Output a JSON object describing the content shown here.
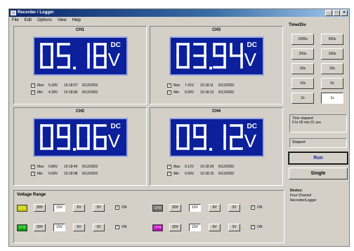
{
  "window": {
    "title": "Recorder / Logger"
  },
  "menu": [
    "File",
    "Edit",
    "Options",
    "View",
    "Help"
  ],
  "channels": [
    {
      "name": "CH1",
      "display": "05.18",
      "dc": "DC",
      "unit": "V",
      "max": {
        "label": "Max",
        "value": "5.18V",
        "time": "10:18:07",
        "date": "6/12/2002"
      },
      "min": {
        "label": "Min",
        "value": "4.28V",
        "time": "10:18:06",
        "date": "6/12/2002"
      }
    },
    {
      "name": "CH3",
      "display": "03.94",
      "dc": "DC",
      "unit": "V",
      "max": {
        "label": "Max",
        "value": "7.41V",
        "time": "10:18:11",
        "date": "6/12/2002"
      },
      "min": {
        "label": "Min",
        "value": "0.00V",
        "time": "10:18:12",
        "date": "6/12/2002"
      }
    },
    {
      "name": "CH2",
      "display": "09.06",
      "dc": "DC",
      "unit": "V",
      "max": {
        "label": "Max",
        "value": "9.86V",
        "time": "10:18:40",
        "date": "6/12/2002"
      },
      "min": {
        "label": "Min",
        "value": "0.00V",
        "time": "10:18:08",
        "date": "6/12/2002"
      }
    },
    {
      "name": "CH4",
      "display": "09.12",
      "dc": "DC",
      "unit": "V",
      "max": {
        "label": "Max",
        "value": "9.12V",
        "time": "10:18:26",
        "date": "6/12/2002"
      },
      "min": {
        "label": "Min",
        "value": "0.00V",
        "time": "10:18:15",
        "date": "6/12/2002"
      }
    }
  ],
  "timediv": {
    "title": "Time/Div",
    "buttons": [
      "1000s",
      "500s",
      "200s",
      "100s",
      "50s",
      "20s",
      "10s",
      "5s",
      "2s",
      "1s"
    ],
    "selected": "1s"
  },
  "elapsed": {
    "label": "Time elapsed",
    "value": "0 hr 00 min 01 sec"
  },
  "status": "Stopped",
  "run_label": "Run",
  "single_label": "Single",
  "device": {
    "label": "Device:",
    "line1": "Four Channel",
    "line2": "Recorder/Logger"
  },
  "voltage_range": {
    "title": "Voltage Range",
    "ranges": [
      "30V",
      "15V",
      "6V",
      "3V"
    ],
    "on_label": "ON",
    "rows": [
      {
        "channel": "CH1",
        "color": "#c8c800",
        "selected": "15V"
      },
      {
        "channel": "CH3",
        "color": "#6e6e6e",
        "selected": "15V"
      },
      {
        "channel": "CH2",
        "color": "#00a000",
        "selected": "15V"
      },
      {
        "channel": "CH4",
        "color": "#c000c0",
        "selected": "15V"
      }
    ]
  },
  "colors": {
    "lcd_bg": "#0b209a",
    "lcd_fg": "#ffffff",
    "title_bar": "#0a246a",
    "face": "#d4d0c8"
  }
}
